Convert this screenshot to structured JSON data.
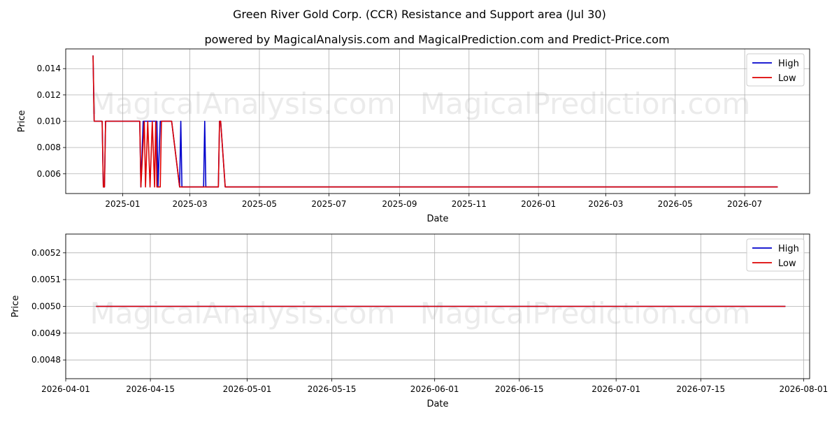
{
  "figure": {
    "title": "Green River Gold Corp. (CCR) Resistance and Support area (Jul 30)",
    "subtitle": "powered by MagicalAnalysis.com and MagicalPrediction.com and Predict-Price.com",
    "watermarks": [
      "MagicalAnalysis.com",
      "MagicalPrediction.com"
    ],
    "colors": {
      "high": "#0000cc",
      "low": "#dd0000",
      "grid": "#b0b0b0"
    }
  },
  "chart_data": [
    {
      "type": "line",
      "xlabel": "Date",
      "ylabel": "Price",
      "xlim": [
        "2024-11-12",
        "2026-08-27"
      ],
      "ylim": [
        0.0045,
        0.0155
      ],
      "x_ticks": [
        "2025-01",
        "2025-03",
        "2025-05",
        "2025-07",
        "2025-09",
        "2025-11",
        "2026-01",
        "2026-03",
        "2026-05",
        "2026-07"
      ],
      "x_tick_dates": [
        "2025-01-01",
        "2025-03-01",
        "2025-05-01",
        "2025-07-01",
        "2025-09-01",
        "2025-11-01",
        "2026-01-01",
        "2026-03-01",
        "2026-05-01",
        "2026-07-01"
      ],
      "y_ticks": [
        0.006,
        0.008,
        0.01,
        0.012,
        0.014
      ],
      "y_tick_labels": [
        "0.006",
        "0.008",
        "0.010",
        "0.012",
        "0.014"
      ],
      "grid": true,
      "legend": "top-right",
      "series": [
        {
          "name": "High",
          "color": "#0000cc",
          "points": [
            [
              "2024-12-06",
              0.015
            ],
            [
              "2024-12-07",
              0.01
            ],
            [
              "2024-12-14",
              0.01
            ],
            [
              "2024-12-15",
              0.005
            ],
            [
              "2024-12-16",
              0.005
            ],
            [
              "2024-12-17",
              0.01
            ],
            [
              "2025-01-16",
              0.01
            ],
            [
              "2025-01-17",
              0.005
            ],
            [
              "2025-01-19",
              0.01
            ],
            [
              "2025-01-31",
              0.01
            ],
            [
              "2025-02-01",
              0.005
            ],
            [
              "2025-02-03",
              0.01
            ],
            [
              "2025-02-13",
              0.01
            ],
            [
              "2025-02-20",
              0.005
            ],
            [
              "2025-02-21",
              0.01
            ],
            [
              "2025-02-22",
              0.005
            ],
            [
              "2025-03-13",
              0.005
            ],
            [
              "2025-03-14",
              0.01
            ],
            [
              "2025-03-15",
              0.005
            ],
            [
              "2025-03-26",
              0.005
            ],
            [
              "2025-03-27",
              0.01
            ],
            [
              "2025-03-28",
              0.01
            ],
            [
              "2025-04-01",
              0.005
            ],
            [
              "2026-07-30",
              0.005
            ]
          ]
        },
        {
          "name": "Low",
          "color": "#dd0000",
          "points": [
            [
              "2024-12-06",
              0.015
            ],
            [
              "2024-12-07",
              0.01
            ],
            [
              "2024-12-14",
              0.01
            ],
            [
              "2024-12-15",
              0.005
            ],
            [
              "2024-12-16",
              0.005
            ],
            [
              "2024-12-17",
              0.01
            ],
            [
              "2025-01-16",
              0.01
            ],
            [
              "2025-01-17",
              0.005
            ],
            [
              "2025-01-20",
              0.01
            ],
            [
              "2025-01-21",
              0.005
            ],
            [
              "2025-01-23",
              0.01
            ],
            [
              "2025-01-25",
              0.005
            ],
            [
              "2025-01-27",
              0.01
            ],
            [
              "2025-01-29",
              0.005
            ],
            [
              "2025-01-30",
              0.01
            ],
            [
              "2025-01-31",
              0.005
            ],
            [
              "2025-02-03",
              0.005
            ],
            [
              "2025-02-04",
              0.01
            ],
            [
              "2025-02-13",
              0.01
            ],
            [
              "2025-02-20",
              0.005
            ],
            [
              "2025-03-26",
              0.005
            ],
            [
              "2025-03-27",
              0.01
            ],
            [
              "2025-03-28",
              0.01
            ],
            [
              "2025-04-01",
              0.005
            ],
            [
              "2026-07-30",
              0.005
            ]
          ]
        }
      ]
    },
    {
      "type": "line",
      "xlabel": "Date",
      "ylabel": "Price",
      "xlim": [
        "2026-04-01",
        "2026-08-02"
      ],
      "ylim": [
        0.00473,
        0.00527
      ],
      "x_ticks": [
        "2026-04-01",
        "2026-04-15",
        "2026-05-01",
        "2026-05-15",
        "2026-06-01",
        "2026-06-15",
        "2026-07-01",
        "2026-07-15",
        "2026-08-01"
      ],
      "x_tick_dates": [
        "2026-04-01",
        "2026-04-15",
        "2026-05-01",
        "2026-05-15",
        "2026-06-01",
        "2026-06-15",
        "2026-07-01",
        "2026-07-15",
        "2026-08-01"
      ],
      "y_ticks": [
        0.0048,
        0.0049,
        0.005,
        0.0051,
        0.0052
      ],
      "y_tick_labels": [
        "0.0048",
        "0.0049",
        "0.0050",
        "0.0051",
        "0.0052"
      ],
      "grid": true,
      "legend": "top-right",
      "series": [
        {
          "name": "High",
          "color": "#0000cc",
          "points": [
            [
              "2026-04-06",
              0.005
            ],
            [
              "2026-07-29",
              0.005
            ]
          ]
        },
        {
          "name": "Low",
          "color": "#dd0000",
          "points": [
            [
              "2026-04-06",
              0.005
            ],
            [
              "2026-07-29",
              0.005
            ]
          ]
        }
      ]
    }
  ]
}
